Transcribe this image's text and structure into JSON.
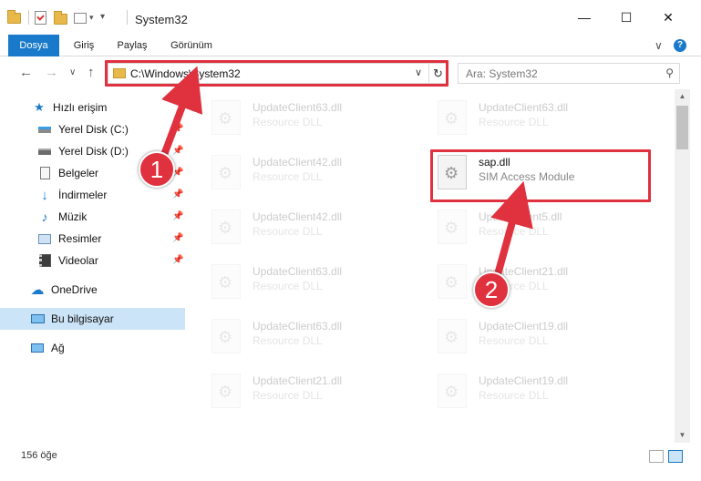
{
  "window": {
    "title": "System32",
    "minimize_glyph": "—",
    "maximize_glyph": "☐",
    "close_glyph": "✕"
  },
  "ribbon": {
    "tabs": [
      {
        "label": "Dosya",
        "active": true
      },
      {
        "label": "Giriş"
      },
      {
        "label": "Paylaş"
      },
      {
        "label": "Görünüm"
      }
    ],
    "expand_glyph": "∨",
    "help_glyph": "?"
  },
  "nav": {
    "back_glyph": "←",
    "forward_glyph": "→",
    "recent_glyph": "∨",
    "up_glyph": "↑",
    "address": "C:\\Windows\\System32",
    "address_dropdown_glyph": "∨",
    "refresh_glyph": "↻",
    "search_placeholder": "Ara: System32",
    "search_glyph": "⚲"
  },
  "sidebar": {
    "quick_access": "Hızlı erişim",
    "items": [
      {
        "label": "Yerel Disk (C:)",
        "icon": "drive-icon",
        "pinned": true
      },
      {
        "label": "Yerel Disk (D:)",
        "icon": "drive-icon",
        "pinned": true
      },
      {
        "label": "Belgeler",
        "icon": "documents-icon",
        "pinned": true
      },
      {
        "label": "İndirmeler",
        "icon": "download-icon",
        "pinned": true
      },
      {
        "label": "Müzik",
        "icon": "music-icon",
        "pinned": true
      },
      {
        "label": "Resimler",
        "icon": "pictures-icon",
        "pinned": true
      },
      {
        "label": "Videolar",
        "icon": "videos-icon",
        "pinned": true
      }
    ],
    "onedrive": "OneDrive",
    "this_pc": "Bu bilgisayar",
    "network": "Ağ",
    "pin_glyph": "📌"
  },
  "files": {
    "left": [
      {
        "name": "UpdateClient63.dll",
        "desc": "Resource DLL"
      },
      {
        "name": "UpdateClient42.dll",
        "desc": "Resource DLL"
      },
      {
        "name": "UpdateClient42.dll",
        "desc": "Resource DLL"
      },
      {
        "name": "UpdateClient63.dll",
        "desc": "Resource DLL"
      },
      {
        "name": "UpdateClient63.dll",
        "desc": "Resource DLL"
      },
      {
        "name": "UpdateClient21.dll",
        "desc": "Resource DLL"
      }
    ],
    "right": [
      {
        "name": "UpdateClient63.dll",
        "desc": "Resource DLL"
      },
      {
        "name": "sap.dll",
        "desc": "SIM Access Module",
        "highlighted": true
      },
      {
        "name": "UpdateClient5.dll",
        "desc": "Resource DLL"
      },
      {
        "name": "UpdateClient21.dll",
        "desc": "Resource DLL"
      },
      {
        "name": "UpdateClient19.dll",
        "desc": "Resource DLL"
      },
      {
        "name": "UpdateClient19.dll",
        "desc": "Resource DLL"
      }
    ]
  },
  "status": {
    "count": "156 öğe"
  },
  "annotations": {
    "badge1": "1",
    "badge2": "2",
    "color": "#e0313f"
  },
  "colors": {
    "accent": "#1979ca",
    "selection": "#cce4f7",
    "folder": "#e8b94a"
  }
}
